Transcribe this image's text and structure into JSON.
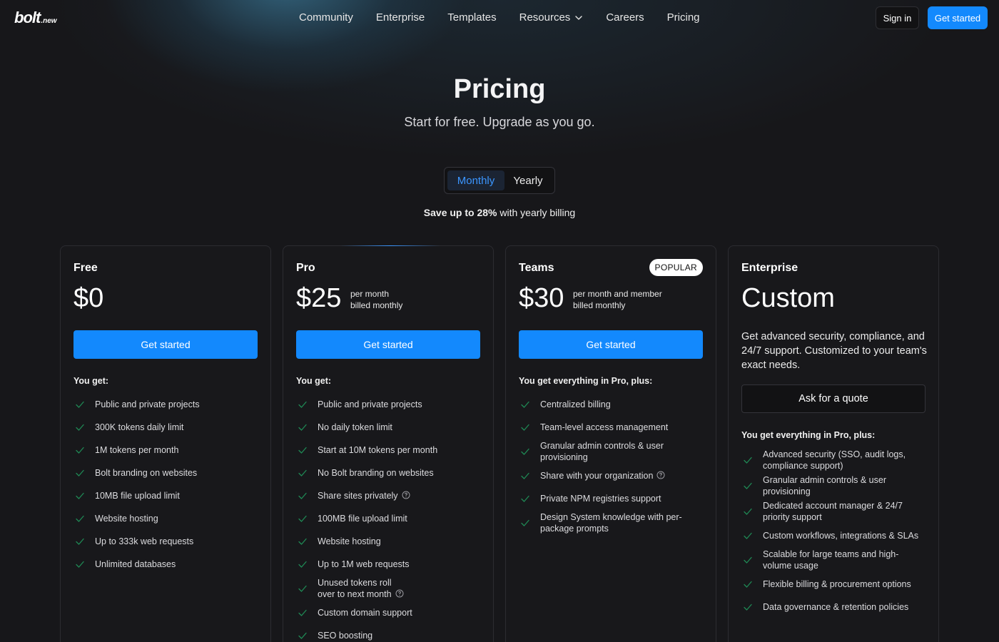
{
  "nav": {
    "logo_main": "bolt",
    "logo_sub": ".new",
    "links": [
      {
        "label": "Community"
      },
      {
        "label": "Enterprise"
      },
      {
        "label": "Templates"
      },
      {
        "label": "Resources",
        "has_dropdown": true
      },
      {
        "label": "Careers"
      },
      {
        "label": "Pricing"
      }
    ],
    "sign_in": "Sign in",
    "get_started": "Get started"
  },
  "hero": {
    "title": "Pricing",
    "subtitle": "Start for free. Upgrade as you go."
  },
  "billing_toggle": {
    "options": [
      "Monthly",
      "Yearly"
    ],
    "selected": "Monthly"
  },
  "save_note": {
    "bold": "Save up to 28%",
    "rest": " with yearly billing"
  },
  "colors": {
    "accent": "#1389fd",
    "check": "#1f8a55",
    "background": "#17171a"
  },
  "plans": [
    {
      "name": "Free",
      "price": "$0",
      "price_note_1": "",
      "price_note_2": "",
      "cta": "Get started",
      "features_heading": "You get:",
      "features": [
        {
          "text": "Public and private projects"
        },
        {
          "text": "300K tokens daily limit"
        },
        {
          "text": "1M tokens per month"
        },
        {
          "text": "Bolt branding on websites"
        },
        {
          "text": "10MB file upload limit"
        },
        {
          "text": "Website hosting"
        },
        {
          "text": "Up to 333k web requests"
        },
        {
          "text": "Unlimited databases"
        }
      ]
    },
    {
      "name": "Pro",
      "price": "$25",
      "price_note_1": "per month",
      "price_note_2": "billed monthly",
      "cta": "Get started",
      "features_heading": "You get:",
      "features": [
        {
          "text": "Public and private projects"
        },
        {
          "text": "No daily token limit"
        },
        {
          "text": "Start at 10M tokens per month"
        },
        {
          "text": "No Bolt branding on websites"
        },
        {
          "text": "Share sites privately",
          "info": true
        },
        {
          "text": "100MB file upload limit"
        },
        {
          "text": "Website hosting"
        },
        {
          "text": "Up to 1M web requests"
        },
        {
          "text": "Unused tokens roll",
          "text2": "over to next month",
          "info": true
        },
        {
          "text": "Custom domain support"
        },
        {
          "text": "SEO boosting"
        }
      ]
    },
    {
      "name": "Teams",
      "badge": "POPULAR",
      "price": "$30",
      "price_note_1": "per month and member",
      "price_note_2": "billed monthly",
      "cta": "Get started",
      "features_heading": "You get everything in Pro, plus:",
      "features": [
        {
          "text": "Centralized billing"
        },
        {
          "text": "Team-level access management"
        },
        {
          "text": "Granular admin controls & user",
          "text2": "provisioning"
        },
        {
          "text": "Share with your organization",
          "info": true
        },
        {
          "text": "Private NPM registries support"
        },
        {
          "text": "Design System knowledge with per-",
          "text2": "package prompts"
        }
      ]
    },
    {
      "name": "Enterprise",
      "price": "Custom",
      "description": "Get advanced security, compliance, and 24/7 support. Customized to your team's exact needs.",
      "cta": "Ask for a quote",
      "features_heading": "You get everything in Pro, plus:",
      "features": [
        {
          "text": "Advanced security (SSO, audit logs,",
          "text2": "compliance support)"
        },
        {
          "text": "Granular admin controls & user",
          "text2": "provisioning"
        },
        {
          "text": "Dedicated account manager & 24/7",
          "text2": "priority support"
        },
        {
          "text": "Custom workflows, integrations & SLAs"
        },
        {
          "text": "Scalable for large teams and high-",
          "text2": "volume usage"
        },
        {
          "text": "Flexible billing & procurement options"
        },
        {
          "text": "Data governance & retention policies"
        }
      ]
    }
  ]
}
